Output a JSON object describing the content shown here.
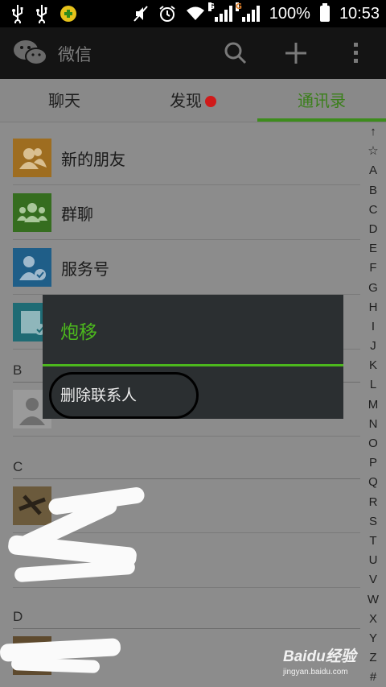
{
  "status_bar": {
    "battery": "100%",
    "time": "10:53",
    "network_label": "G",
    "icons": [
      "usb-icon",
      "usb-icon",
      "app-notification-icon",
      "mute-icon",
      "alarm-icon",
      "wifi-icon",
      "signal-icon",
      "signal-icon",
      "battery-icon"
    ]
  },
  "action_bar": {
    "title": "微信",
    "icons": [
      "wechat-logo",
      "search-icon",
      "add-icon",
      "overflow-menu-icon"
    ]
  },
  "tabs": [
    {
      "label": "聊天",
      "active": false
    },
    {
      "label": "发现",
      "active": false,
      "badge": "red-dot"
    },
    {
      "label": "通讯录",
      "active": true
    }
  ],
  "contacts": {
    "fixed_entries": [
      {
        "label": "新的朋友",
        "icon": "new-friends-icon",
        "color": "#e3961f"
      },
      {
        "label": "群聊",
        "icon": "group-chat-icon",
        "color": "#4c9b2b"
      },
      {
        "label": "服务号",
        "icon": "service-account-icon",
        "color": "#2e86c1"
      },
      {
        "label": "",
        "icon": "tag-icon",
        "color": "#2b9aa6"
      }
    ],
    "sections": [
      "B",
      "C",
      "D"
    ]
  },
  "index_letters": [
    "↑",
    "☆",
    "A",
    "B",
    "C",
    "D",
    "E",
    "F",
    "G",
    "H",
    "I",
    "J",
    "K",
    "L",
    "M",
    "N",
    "O",
    "P",
    "Q",
    "R",
    "S",
    "T",
    "U",
    "V",
    "W",
    "X",
    "Y",
    "Z",
    "#"
  ],
  "dialog": {
    "title": "炮移",
    "item": "删除联系人"
  },
  "watermark": {
    "brand": "Baidu经验",
    "url": "jingyan.baidu.com"
  },
  "colors": {
    "accent": "#4cb81d",
    "status_bar": "#000000",
    "action_bar": "#141414",
    "dim_overlay": "#8c8c8c",
    "dialog_bg": "#2b2f31"
  }
}
